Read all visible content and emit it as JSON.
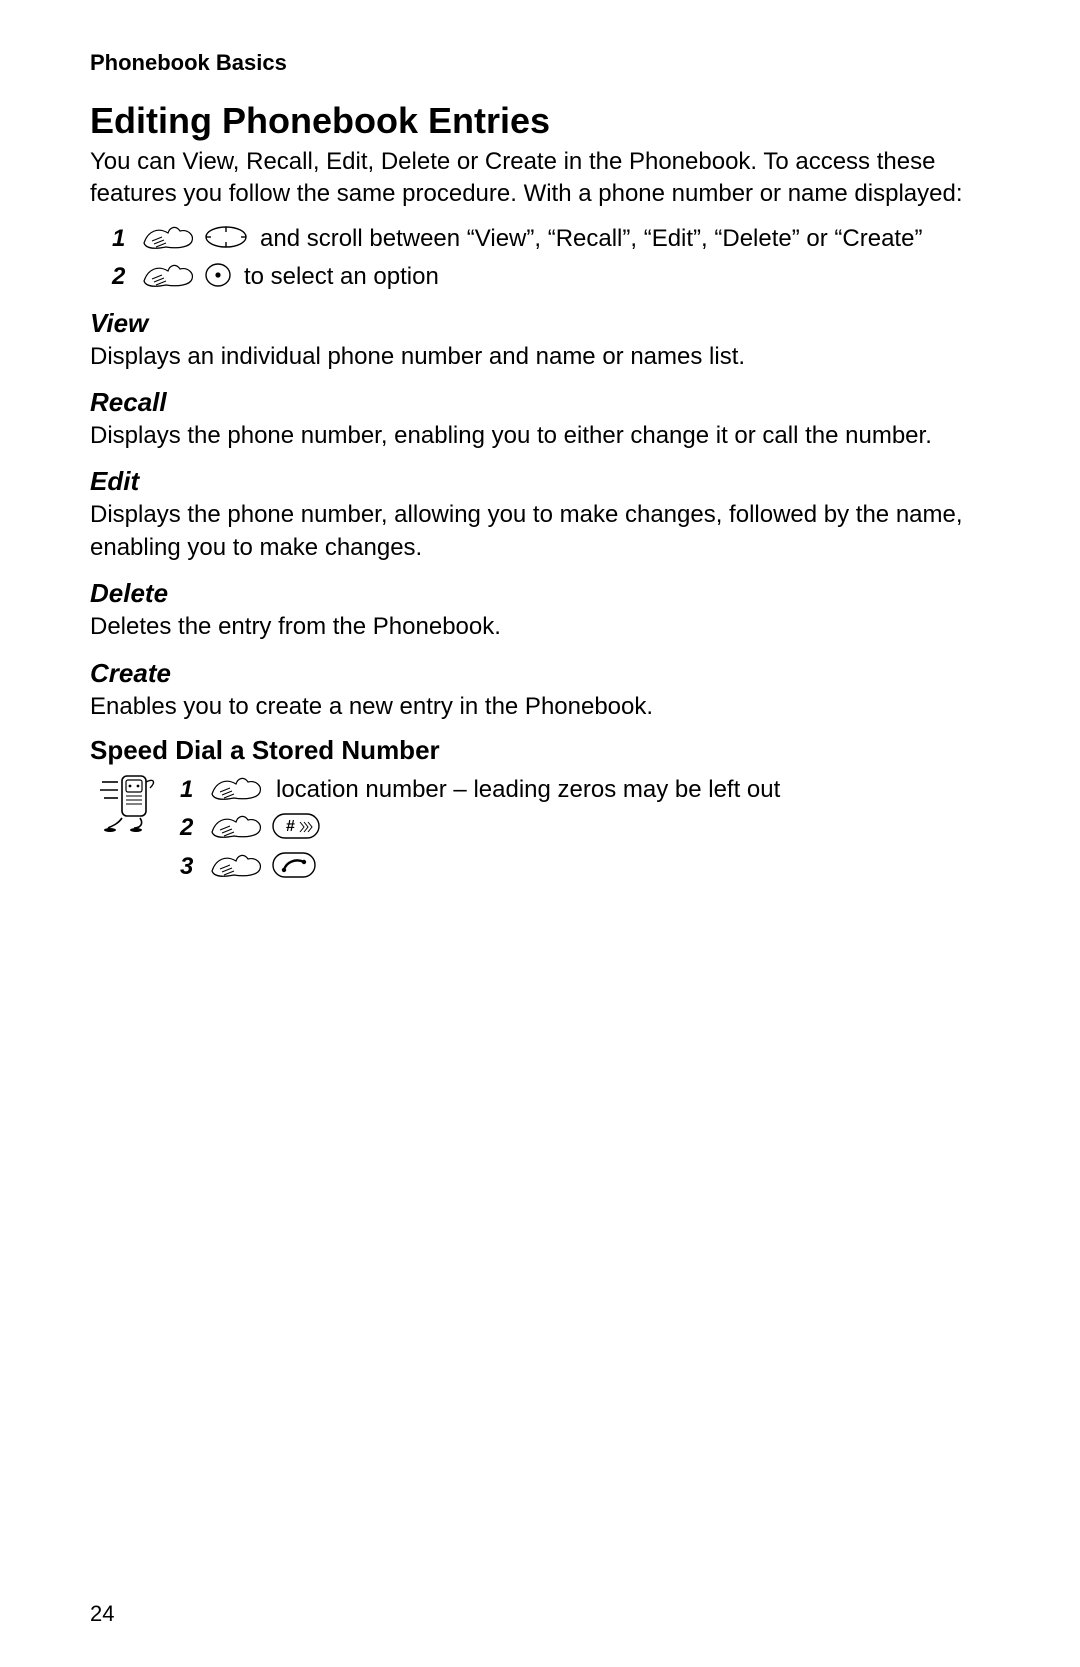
{
  "header": "Phonebook Basics",
  "title": "Editing Phonebook Entries",
  "intro": "You can View, Recall, Edit, Delete or Create in the Phonebook. To access these features you follow the same procedure. With a phone number or name displayed:",
  "steps_top": {
    "n1": "1",
    "t1": "and scroll between “View”, “Recall”, “Edit”, “Delete” or “Create”",
    "n2": "2",
    "t2": "to select an option"
  },
  "sections": {
    "view_h": "View",
    "view_p": "Displays an individual phone number and name or names list.",
    "recall_h": "Recall",
    "recall_p": "Displays the phone number, enabling you to either change it or call the number.",
    "edit_h": "Edit",
    "edit_p": "Displays the phone number, allowing you to make changes, followed by the name, enabling you to make changes.",
    "delete_h": "Delete",
    "delete_p": "Deletes the entry from the Phonebook.",
    "create_h": "Create",
    "create_p": "Enables you to create a new entry in the Phonebook."
  },
  "speed": {
    "heading": "Speed Dial a Stored Number",
    "n1": "1",
    "t1": "location number – leading zeros may be left out",
    "n2": "2",
    "n3": "3"
  },
  "page_number": "24"
}
